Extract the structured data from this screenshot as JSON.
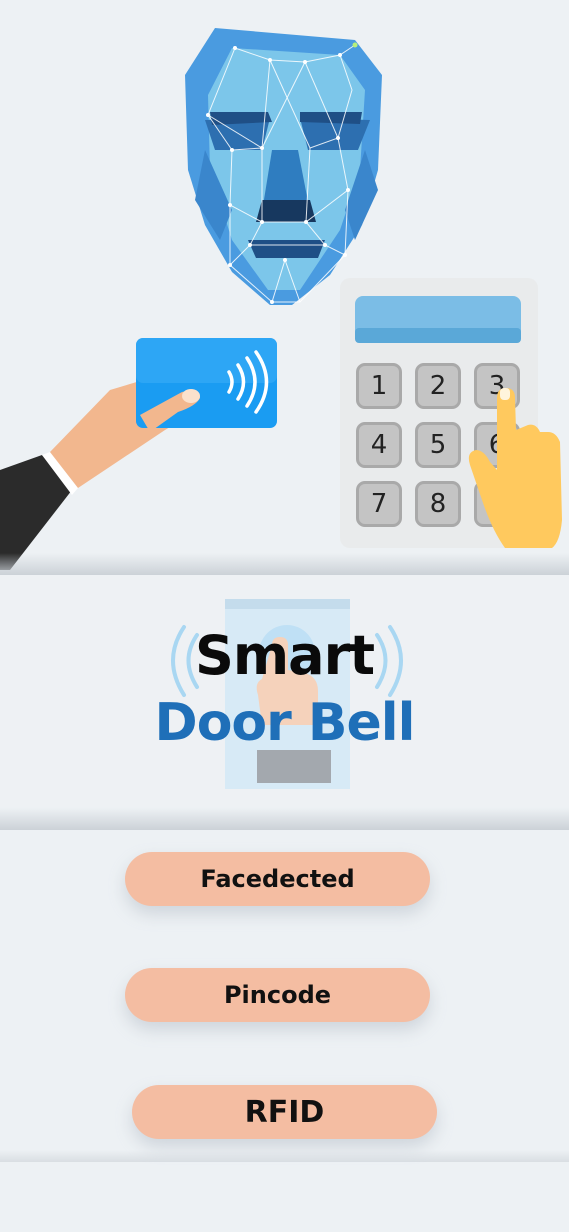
{
  "colors": {
    "background": "#edf1f4",
    "pill": "#f4bda2",
    "title_dark": "#0a0a0a",
    "title_blue": "#1f6fb8",
    "face_blue": "#4a9be0",
    "card_blue": "#1a9cf2"
  },
  "hero": {
    "keypad_keys": [
      "1",
      "2",
      "3",
      "4",
      "5",
      "6",
      "7",
      "8"
    ]
  },
  "title": {
    "line1": "Smart",
    "line2": "Door Bell"
  },
  "menu": {
    "items": [
      {
        "label": "Facedected"
      },
      {
        "label": "Pincode"
      },
      {
        "label": "RFID"
      }
    ]
  }
}
